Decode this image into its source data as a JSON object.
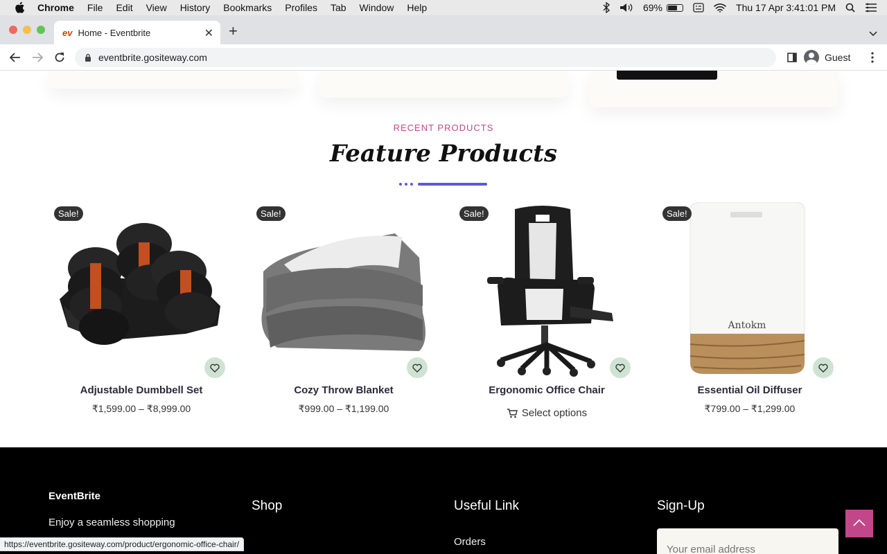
{
  "menubar": {
    "app": "Chrome",
    "items": [
      "File",
      "Edit",
      "View",
      "History",
      "Bookmarks",
      "Profiles",
      "Tab",
      "Window",
      "Help"
    ],
    "battery": "69%",
    "datetime": "Thu 17 Apr  3:41:01 PM"
  },
  "browser": {
    "tab_favicon": "ev",
    "tab_title": "Home - Eventbrite",
    "url": "eventbrite.gositeway.com",
    "profile": "Guest",
    "status_url": "https://eventbrite.gositeway.com/product/ergonomic-office-chair/"
  },
  "section": {
    "eyebrow": "RECENT PRODUCTS",
    "title": "Feature Products"
  },
  "products": [
    {
      "badge": "Sale!",
      "name": "Adjustable Dumbbell Set",
      "price": "₹1,599.00 – ₹8,999.00",
      "image": "dumbbell-image"
    },
    {
      "badge": "Sale!",
      "name": "Cozy Throw Blanket",
      "price": "₹999.00 – ₹1,199.00",
      "image": "blanket-image"
    },
    {
      "badge": "Sale!",
      "name": "Ergonomic Office Chair",
      "action": "Select options",
      "image": "office-chair-image"
    },
    {
      "badge": "Sale!",
      "name": "Essential Oil Diffuser",
      "price": "₹799.00 – ₹1,299.00",
      "image": "diffuser-image",
      "image_text": "Antokm"
    }
  ],
  "footer": {
    "brand": "EventBrite",
    "description": "Enjoy a seamless shopping",
    "shop_title": "Shop",
    "useful_title": "Useful Link",
    "useful_first": "Orders",
    "signup_title": "Sign-Up",
    "email_placeholder": "Your email address"
  },
  "colors": {
    "accent_pink": "#c2478a",
    "accent_indigo": "#5b59d6",
    "wishlist_bg": "#cfe3d3"
  }
}
